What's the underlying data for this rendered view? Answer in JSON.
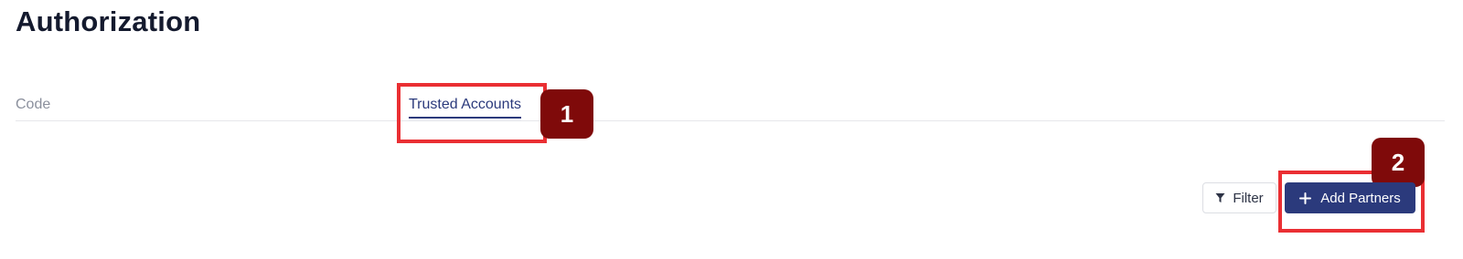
{
  "page": {
    "title": "Authorization"
  },
  "tabs": [
    {
      "label": "Code",
      "active": false
    },
    {
      "label": "Trusted Accounts",
      "active": true
    }
  ],
  "annotations": [
    {
      "number": "1",
      "target": "tab-trusted-accounts"
    },
    {
      "number": "2",
      "target": "add-partners-button"
    }
  ],
  "toolbar": {
    "filter_label": "Filter",
    "filter_icon": "filter-icon",
    "add_label": "Add Partners",
    "add_icon": "plus-icon"
  },
  "colors": {
    "primary": "#2b3a7c",
    "annotation_border": "#ea2f33",
    "annotation_badge": "#7f0a0a",
    "inactive_tab_text": "#8a8f9c"
  }
}
